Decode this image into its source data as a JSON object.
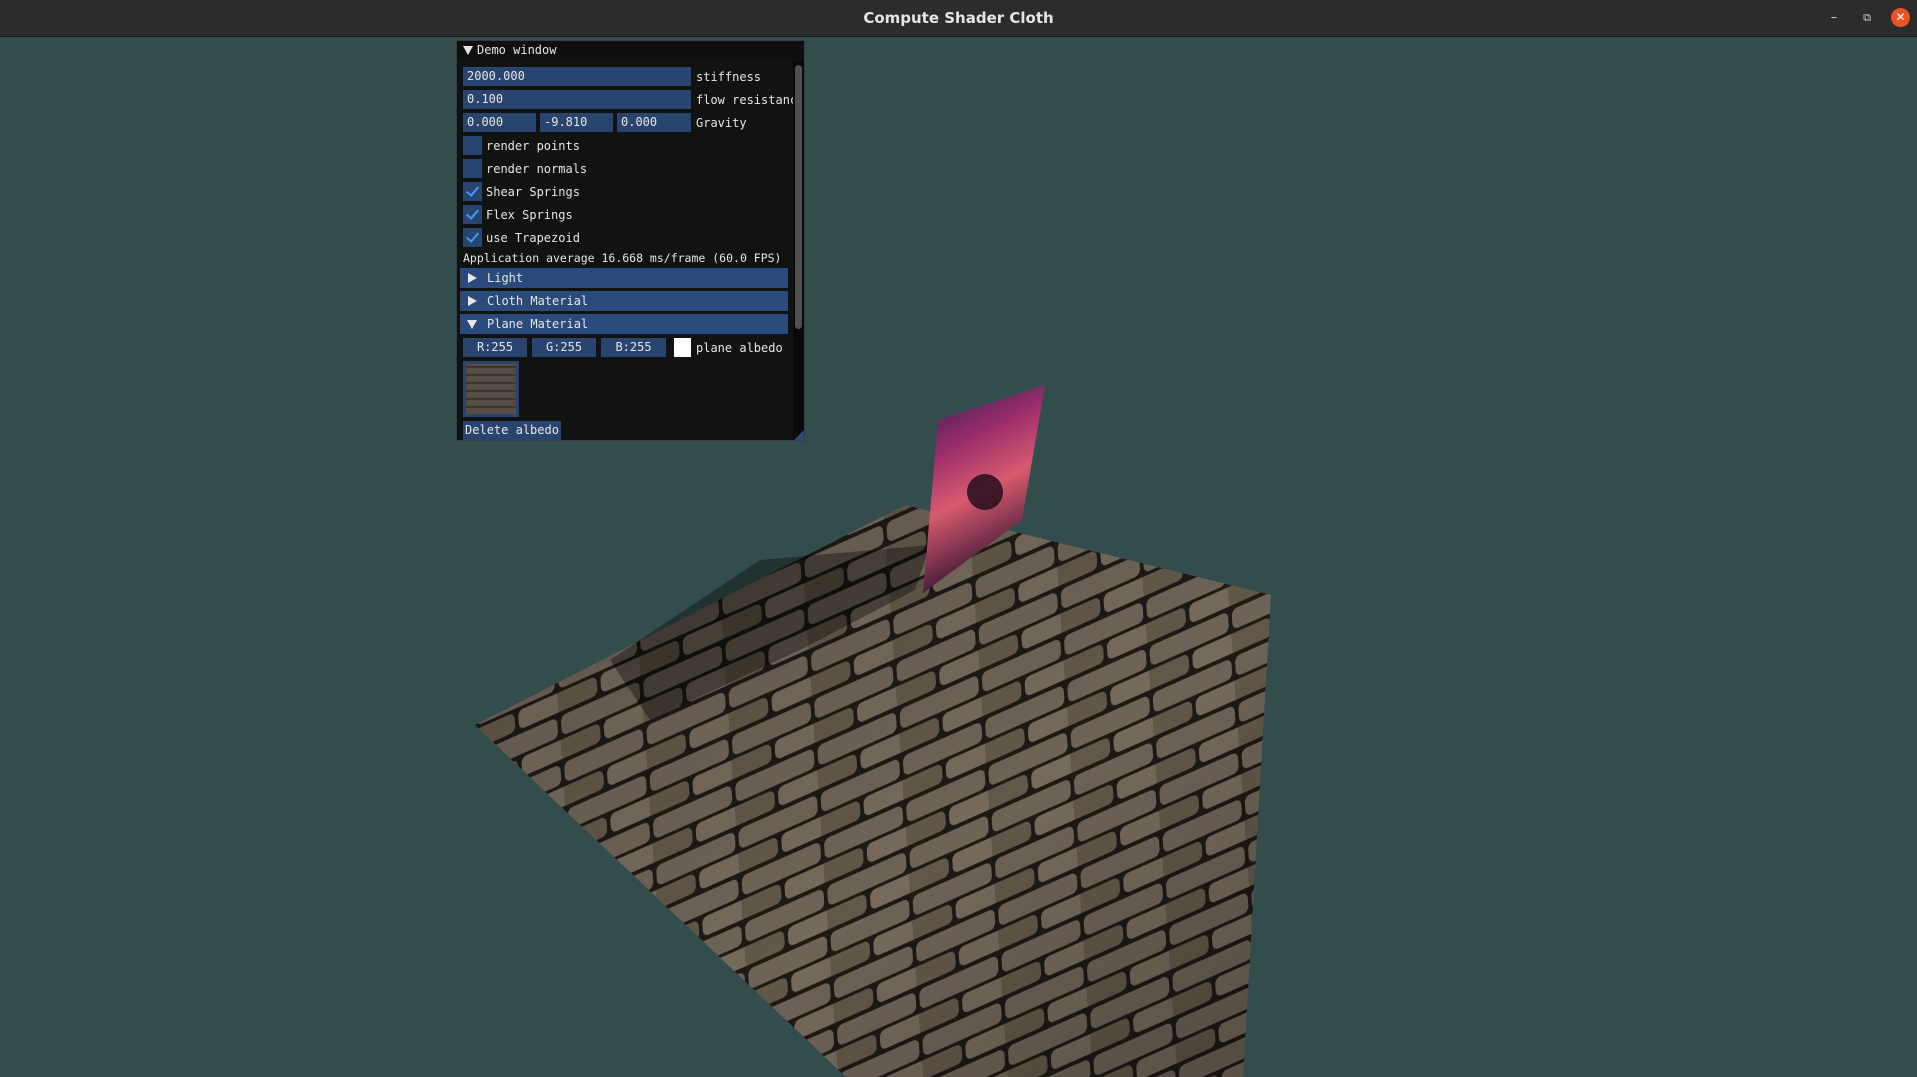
{
  "window": {
    "title": "Compute Shader Cloth",
    "minimize": "–",
    "maximize": "⧉",
    "close": "✕"
  },
  "panel": {
    "title": "Demo window",
    "stiffness": {
      "value": "2000.000",
      "label": "stiffness"
    },
    "flow": {
      "value": "0.100",
      "label": "flow resistanc"
    },
    "gravity": {
      "x": "0.000",
      "y": "-9.810",
      "z": "0.000",
      "label": "Gravity"
    },
    "checkboxes": [
      {
        "label": "render points",
        "checked": false
      },
      {
        "label": "render normals",
        "checked": false
      },
      {
        "label": "Shear Springs",
        "checked": true
      },
      {
        "label": "Flex Springs",
        "checked": true
      },
      {
        "label": "use Trapezoid",
        "checked": true
      }
    ],
    "fps_text": "Application average 16.668 ms/frame (60.0 FPS)",
    "headers": [
      {
        "label": "Light",
        "open": false
      },
      {
        "label": "Cloth Material",
        "open": false
      },
      {
        "label": "Plane Material",
        "open": true
      }
    ],
    "albedo": {
      "r": "R:255",
      "g": "G:255",
      "b": "B:255",
      "label": "plane albedo",
      "color": "#ffffff"
    },
    "delete_button": "Delete albedo"
  },
  "colors": {
    "background": "#334d4d",
    "frame_bg": "#29446e",
    "header_bg": "#2a4a7c",
    "check_mark": "#4296fa",
    "close_button": "#e95420"
  }
}
